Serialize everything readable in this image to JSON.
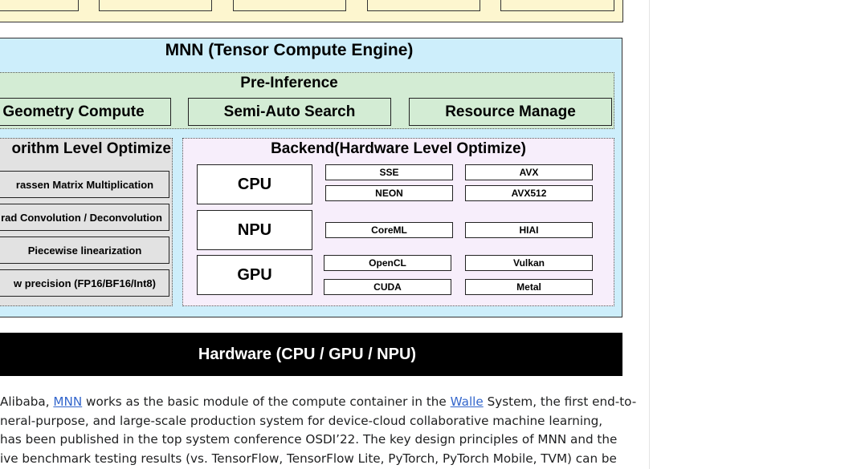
{
  "diagram": {
    "mnn_title": "MNN (Tensor Compute Engine)",
    "pre_inference": {
      "title": "Pre-Inference",
      "items": [
        "Geometry Compute",
        "Semi-Auto Search",
        "Resource Manage"
      ]
    },
    "algorithm": {
      "title": "orithm Level Optimize",
      "items": [
        "rassen Matrix Multiplication",
        "rad Convolution / Deconvolution",
        "Piecewise linearization",
        "w precision (FP16/BF16/Int8)"
      ]
    },
    "backend": {
      "title": "Backend(Hardware Level Optimize)",
      "rows": [
        {
          "name": "CPU",
          "options": [
            "SSE",
            "AVX",
            "NEON",
            "AVX512"
          ]
        },
        {
          "name": "NPU",
          "options": [
            "CoreML",
            "HIAI"
          ]
        },
        {
          "name": "GPU",
          "options": [
            "OpenCL",
            "Vulkan",
            "CUDA",
            "Metal"
          ]
        }
      ]
    },
    "hardware": "Hardware (CPU / GPU / NPU)"
  },
  "article": {
    "line1_a": "Alibaba, ",
    "link_mnn": "MNN",
    "line1_b": " works as the basic module of the compute container in the ",
    "link_walle": "Walle",
    "line1_c": " System, the first end-to-",
    "line2": "neral-purpose, and large-scale production system for device-cloud collaborative machine learning,",
    "line3": "has been published in the top system conference OSDI’22. The key design principles of MNN and the",
    "line4": "ive benchmark testing results (vs. TensorFlow, TensorFlow Lite, PyTorch, PyTorch Mobile, TVM) can be"
  }
}
